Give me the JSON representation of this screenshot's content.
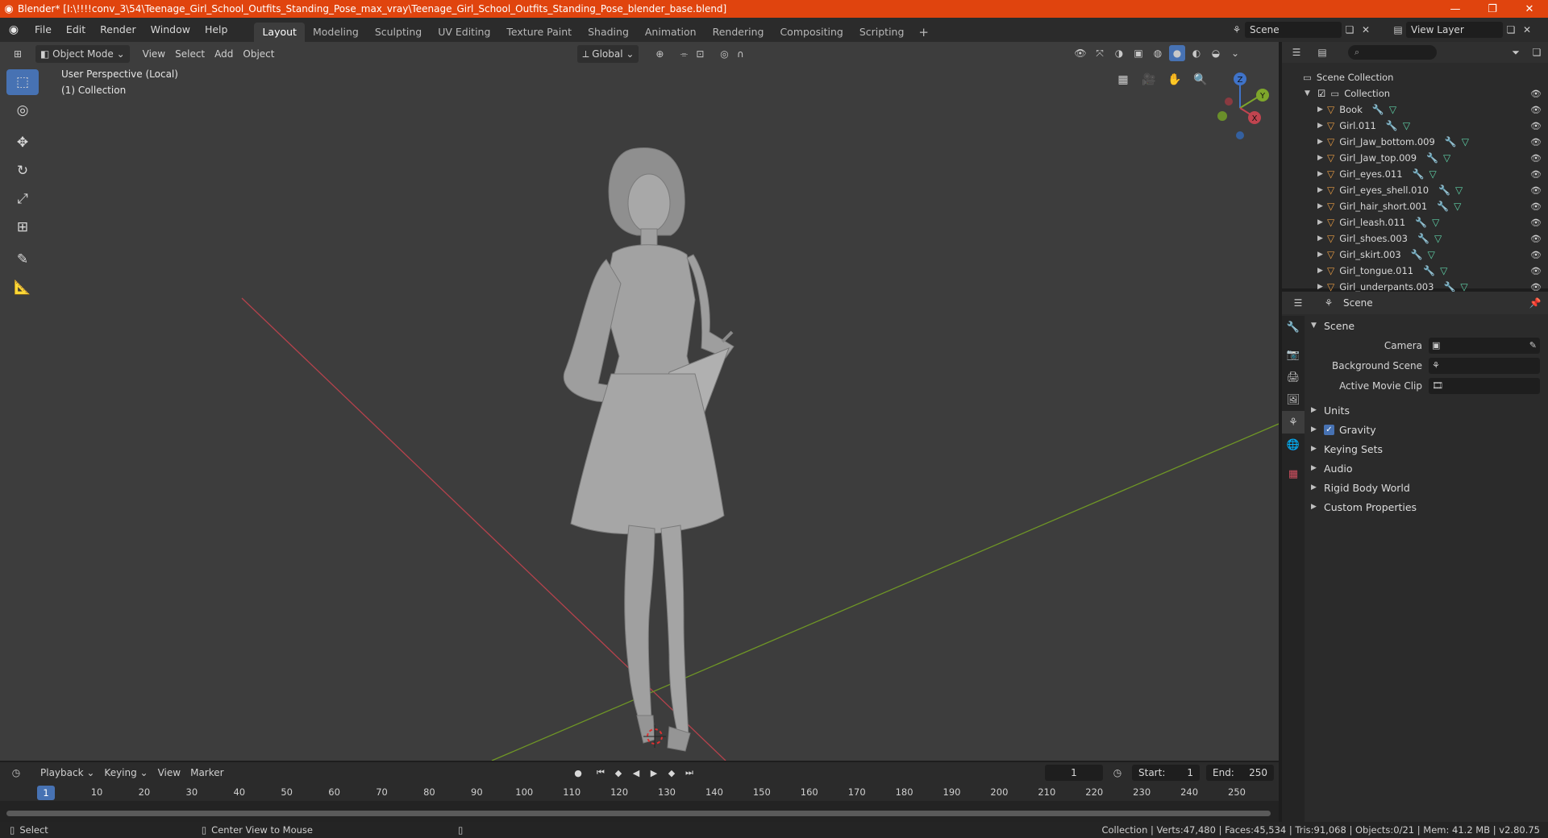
{
  "window": {
    "title": "Blender* [I:\\!!!!conv_3\\54\\Teenage_Girl_School_Outfits_Standing_Pose_max_vray\\Teenage_Girl_School_Outfits_Standing_Pose_blender_base.blend]",
    "minimize": "—",
    "maximize": "❐",
    "close": "✕"
  },
  "menu": [
    "File",
    "Edit",
    "Render",
    "Window",
    "Help"
  ],
  "workspaces": [
    "Layout",
    "Modeling",
    "Sculpting",
    "UV Editing",
    "Texture Paint",
    "Shading",
    "Animation",
    "Rendering",
    "Compositing",
    "Scripting"
  ],
  "workspace_add": "+",
  "scene_name": "Scene",
  "view_layer": "View Layer",
  "viewport": {
    "mode": "Object Mode",
    "menus": [
      "View",
      "Select",
      "Add",
      "Object"
    ],
    "orientation": "Global",
    "info_line1": "User Perspective (Local)",
    "info_line2": "(1) Collection"
  },
  "gizmo": {
    "x": "X",
    "y": "Y",
    "z": "Z"
  },
  "outliner": {
    "root": "Scene Collection",
    "collection": "Collection",
    "items": [
      "Book",
      "Girl.011",
      "Girl_Jaw_bottom.009",
      "Girl_Jaw_top.009",
      "Girl_eyes.011",
      "Girl_eyes_shell.010",
      "Girl_hair_short.001",
      "Girl_leash.011",
      "Girl_shoes.003",
      "Girl_skirt.003",
      "Girl_tongue.011",
      "Girl_underpants.003"
    ]
  },
  "properties": {
    "header": "Scene",
    "section": "Scene",
    "camera_label": "Camera",
    "bg_scene_label": "Background Scene",
    "movie_clip_label": "Active Movie Clip",
    "panels": [
      "Units",
      "Gravity",
      "Keying Sets",
      "Audio",
      "Rigid Body World",
      "Custom Properties"
    ]
  },
  "timeline": {
    "menus": [
      "Playback",
      "Keying",
      "View",
      "Marker"
    ],
    "current_frame": "1",
    "start_label": "Start:",
    "start": "1",
    "end_label": "End:",
    "end": "250",
    "ticks": [
      "1",
      "10",
      "20",
      "30",
      "40",
      "50",
      "60",
      "70",
      "80",
      "90",
      "100",
      "110",
      "120",
      "130",
      "140",
      "150",
      "160",
      "170",
      "180",
      "190",
      "200",
      "210",
      "220",
      "230",
      "240",
      "250"
    ]
  },
  "status": {
    "left1": "Select",
    "left2": "Center View to Mouse",
    "right": "Collection | Verts:47,480 | Faces:45,534 | Tris:91,068 | Objects:0/21 | Mem: 41.2 MB | v2.80.75"
  },
  "colors": {
    "titlebar": "#e0440e",
    "accent": "#4772b3",
    "viewport_bg": "#3d3d3d",
    "x_axis": "#c0444f",
    "y_axis": "#7ea62b"
  }
}
